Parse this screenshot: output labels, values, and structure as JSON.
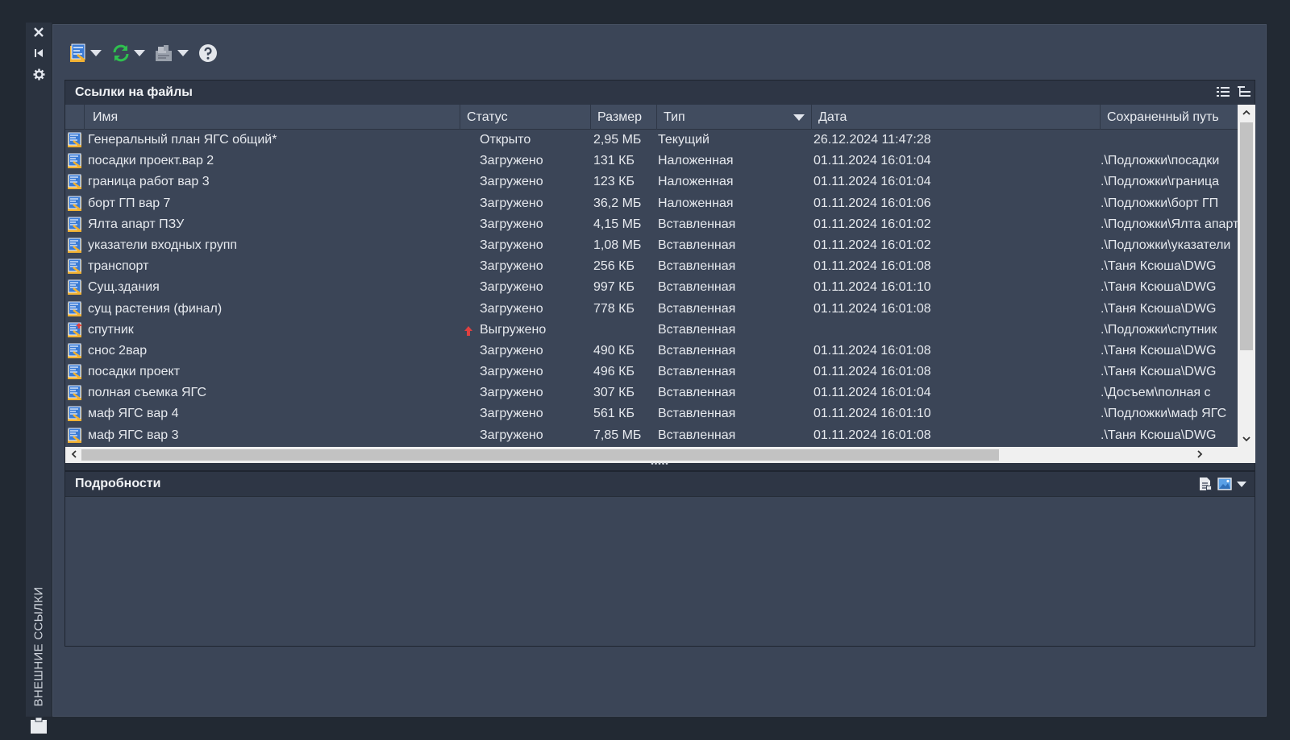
{
  "palette": {
    "title": "ВНЕШНИЕ ССЫЛКИ"
  },
  "sections": {
    "refs_title": "Ссылки на файлы",
    "details_title": "Подробности"
  },
  "icons": {
    "close": "close-icon",
    "auto_hide": "auto-hide-icon",
    "settings": "gear-icon",
    "attach": "attach-dwg-icon",
    "refresh": "refresh-icon",
    "change_path": "change-path-icon",
    "help": "help-icon"
  },
  "columns": {
    "name": "Имя",
    "status": "Статус",
    "size": "Размер",
    "type": "Тип",
    "date": "Дата",
    "path": "Сохраненный путь"
  },
  "rows": [
    {
      "name": "Генеральный план ЯГС общий*",
      "status": "Открыто",
      "size": "2,95 МБ",
      "type": "Текущий",
      "date": "26.12.2024 11:47:28",
      "path": ""
    },
    {
      "name": "посадки проект.вар 2",
      "status": "Загружено",
      "size": "131 КБ",
      "type": "Наложенная",
      "date": "01.11.2024 16:01:04",
      "path": ".\\Подложки\\посадки"
    },
    {
      "name": "граница работ вар 3",
      "status": "Загружено",
      "size": "123 КБ",
      "type": "Наложенная",
      "date": "01.11.2024 16:01:04",
      "path": ".\\Подложки\\граница"
    },
    {
      "name": "борт ГП вар 7",
      "status": "Загружено",
      "size": "36,2 МБ",
      "type": "Наложенная",
      "date": "01.11.2024 16:01:06",
      "path": ".\\Подложки\\борт ГП"
    },
    {
      "name": "Ялта апарт ПЗУ",
      "status": "Загружено",
      "size": "4,15 МБ",
      "type": "Вставленная",
      "date": "01.11.2024 16:01:02",
      "path": ".\\Подложки\\Ялта апарт"
    },
    {
      "name": "указатели входных групп",
      "status": "Загружено",
      "size": "1,08 МБ",
      "type": "Вставленная",
      "date": "01.11.2024 16:01:02",
      "path": ".\\Подложки\\указатели"
    },
    {
      "name": "транспорт",
      "status": "Загружено",
      "size": "256 КБ",
      "type": "Вставленная",
      "date": "01.11.2024 16:01:08",
      "path": ".\\Таня Ксюша\\DWG"
    },
    {
      "name": "Сущ.здания",
      "status": "Загружено",
      "size": "997 КБ",
      "type": "Вставленная",
      "date": "01.11.2024 16:01:10",
      "path": ".\\Таня Ксюша\\DWG"
    },
    {
      "name": "сущ растения (финал)",
      "status": "Загружено",
      "size": "778 КБ",
      "type": "Вставленная",
      "date": "01.11.2024 16:01:08",
      "path": ".\\Таня Ксюша\\DWG"
    },
    {
      "name": "спутник",
      "status": "Выгружено",
      "size": "",
      "type": "Вставленная",
      "date": "",
      "path": ".\\Подложки\\спутник",
      "unloaded": true
    },
    {
      "name": "снос 2вар",
      "status": "Загружено",
      "size": "490 КБ",
      "type": "Вставленная",
      "date": "01.11.2024 16:01:08",
      "path": ".\\Таня Ксюша\\DWG"
    },
    {
      "name": "посадки проект",
      "status": "Загружено",
      "size": "496 КБ",
      "type": "Вставленная",
      "date": "01.11.2024 16:01:08",
      "path": ".\\Таня Ксюша\\DWG"
    },
    {
      "name": "полная съемка ЯГС",
      "status": "Загружено",
      "size": "307 КБ",
      "type": "Вставленная",
      "date": "01.11.2024 16:01:04",
      "path": ".\\Досъем\\полная с"
    },
    {
      "name": "маф ЯГС вар 4",
      "status": "Загружено",
      "size": "561 КБ",
      "type": "Вставленная",
      "date": "01.11.2024 16:01:10",
      "path": ".\\Подложки\\маф ЯГС"
    },
    {
      "name": "маф ЯГС вар 3",
      "status": "Загружено",
      "size": "7,85 МБ",
      "type": "Вставленная",
      "date": "01.11.2024 16:01:08",
      "path": ".\\Таня Ксюша\\DWG"
    }
  ],
  "colors": {
    "panel_bg": "#3b4557",
    "header_bg": "#414c5f",
    "dwg_blue": "#3a7bd5",
    "dwg_yellow": "#f2b233",
    "refresh_green": "#2fbf4f",
    "unload_red": "#e04040"
  }
}
